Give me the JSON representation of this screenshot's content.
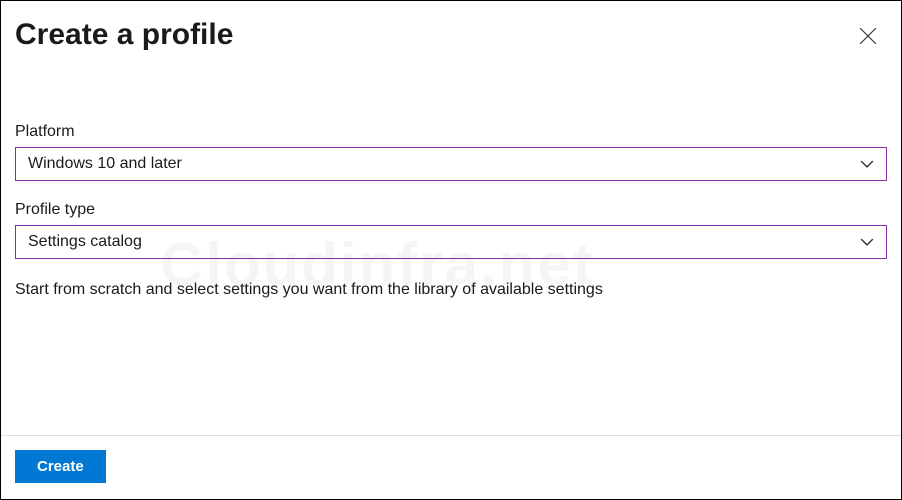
{
  "header": {
    "title": "Create a profile"
  },
  "form": {
    "platform": {
      "label": "Platform",
      "value": "Windows 10 and later"
    },
    "profileType": {
      "label": "Profile type",
      "value": "Settings catalog"
    },
    "description": "Start from scratch and select settings you want from the library of available settings"
  },
  "footer": {
    "createLabel": "Create"
  },
  "watermark": "Cloudinfra.net"
}
